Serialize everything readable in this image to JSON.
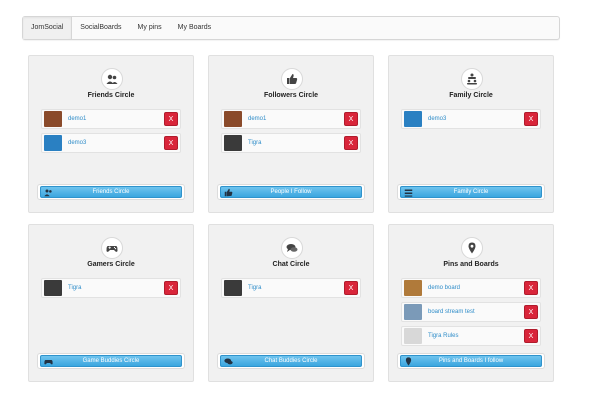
{
  "tabs": [
    {
      "label": "JomSocial"
    },
    {
      "label": "SocialBoards"
    },
    {
      "label": "My pins"
    },
    {
      "label": "My Boards"
    }
  ],
  "circles": [
    {
      "title": "Friends Circle",
      "icon": "friends-icon",
      "members": [
        {
          "name": "demo1",
          "avatar": "photo-woman",
          "remove": "X"
        },
        {
          "name": "demo3",
          "avatar": "default-user",
          "remove": "X"
        }
      ],
      "button": "Friends Circle"
    },
    {
      "title": "Followers Circle",
      "icon": "thumbs-up-icon",
      "members": [
        {
          "name": "demo1",
          "avatar": "photo-woman",
          "remove": "X"
        },
        {
          "name": "Tigra",
          "avatar": "texture-dark",
          "remove": "X"
        }
      ],
      "button": "People I Follow"
    },
    {
      "title": "Family Circle",
      "icon": "family-icon",
      "members": [
        {
          "name": "demo3",
          "avatar": "default-user",
          "remove": "X"
        }
      ],
      "button": "Family Circle"
    },
    {
      "title": "Gamers Circle",
      "icon": "gamepad-icon",
      "members": [
        {
          "name": "Tigra",
          "avatar": "texture-dark",
          "remove": "X"
        }
      ],
      "button": "Game Buddies Circle"
    },
    {
      "title": "Chat Circle",
      "icon": "chat-icon",
      "members": [
        {
          "name": "Tigra",
          "avatar": "texture-dark",
          "remove": "X"
        }
      ],
      "button": "Chat Buddies Circle"
    },
    {
      "title": "Pins and Boards",
      "icon": "map-pin-icon",
      "members": [
        {
          "name": "demo board",
          "avatar": "photo-board",
          "remove": "X"
        },
        {
          "name": "board stream test",
          "avatar": "photo-stream",
          "remove": "X"
        },
        {
          "name": "Tigra Rules",
          "avatar": "photo-doc",
          "remove": "X"
        }
      ],
      "button": "Pins and Boards I follow"
    }
  ]
}
